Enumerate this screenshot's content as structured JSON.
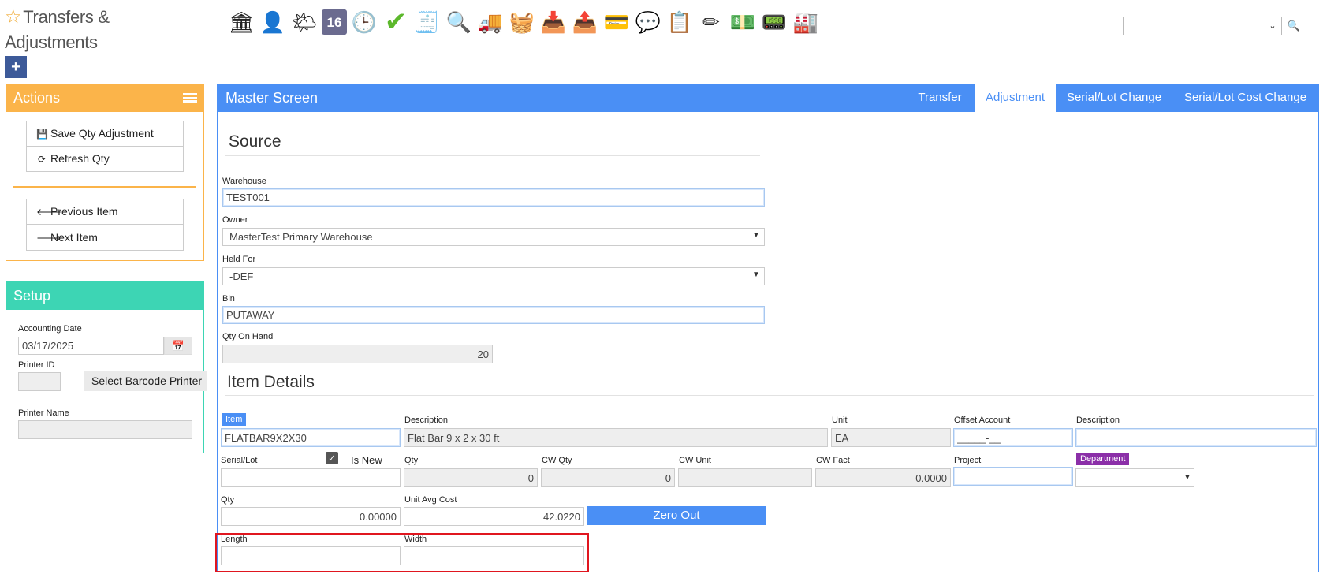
{
  "page": {
    "title": "Transfers & Adjustments"
  },
  "toolbar": {
    "icons": [
      {
        "name": "bank",
        "glyph": "🏛"
      },
      {
        "name": "user",
        "glyph": "👤"
      },
      {
        "name": "weather",
        "glyph": "🌤"
      },
      {
        "name": "calendar-16",
        "glyph": "16"
      },
      {
        "name": "clock",
        "glyph": "🕒"
      },
      {
        "name": "checkmark",
        "glyph": "✔"
      },
      {
        "name": "register",
        "glyph": "🧾"
      },
      {
        "name": "magnifier",
        "glyph": "🔍"
      },
      {
        "name": "truck",
        "glyph": "🚚"
      },
      {
        "name": "basket",
        "glyph": "🧺"
      },
      {
        "name": "inbox-download",
        "glyph": "📥"
      },
      {
        "name": "outbox-upload",
        "glyph": "📤"
      },
      {
        "name": "hand-money",
        "glyph": "💳"
      },
      {
        "name": "dollar-chat",
        "glyph": "💬"
      },
      {
        "name": "clipboard",
        "glyph": "📋"
      },
      {
        "name": "pencil-doc",
        "glyph": "✏"
      },
      {
        "name": "cash",
        "glyph": "💵"
      },
      {
        "name": "dashboard",
        "glyph": "📟"
      },
      {
        "name": "factory",
        "glyph": "🏭"
      }
    ]
  },
  "search": {
    "value": "",
    "dropdown_glyph": "⌄",
    "button_glyph": "🔍"
  },
  "actions": {
    "title": "Actions",
    "save": "Save Qty Adjustment",
    "refresh": "Refresh Qty",
    "previous": "Previous Item",
    "next": "Next Item"
  },
  "setup": {
    "title": "Setup",
    "accounting_date_label": "Accounting Date",
    "accounting_date": "03/17/2025",
    "printer_id_label": "Printer ID",
    "printer_id": "",
    "select_printer": "Select Barcode Printer",
    "printer_name_label": "Printer Name",
    "printer_name": ""
  },
  "master": {
    "title": "Master Screen",
    "tabs": [
      "Transfer",
      "Adjustment",
      "Serial/Lot Change",
      "Serial/Lot Cost Change"
    ],
    "active_tab": "Adjustment"
  },
  "source": {
    "title": "Source",
    "warehouse_label": "Warehouse",
    "warehouse": "TEST001",
    "owner_label": "Owner",
    "owner": "MasterTest Primary Warehouse",
    "held_for_label": "Held For",
    "held_for": "-DEF",
    "bin_label": "Bin",
    "bin": "PUTAWAY",
    "qty_on_hand_label": "Qty On Hand",
    "qty_on_hand": "20"
  },
  "item": {
    "title": "Item Details",
    "item_label": "Item",
    "item": "FLATBAR9X2X30",
    "description_label": "Description",
    "description": "Flat Bar 9 x 2 x 30 ft",
    "unit_label": "Unit",
    "unit": "EA",
    "offset_account_label": "Offset Account",
    "offset_account": "_____-__",
    "description2_label": "Description",
    "description2": "",
    "serial_lot_label": "Serial/Lot",
    "serial_lot": "",
    "is_new_label": "Is New",
    "is_new": true,
    "qty_label": "Qty",
    "qty_readonly": "0",
    "cw_qty_label": "CW Qty",
    "cw_qty": "0",
    "cw_unit_label": "CW Unit",
    "cw_unit": "",
    "cw_fact_label": "CW Fact",
    "cw_fact": "0.0000",
    "project_label": "Project",
    "project": "",
    "department_label": "Department",
    "department": "",
    "qty2_label": "Qty",
    "qty2": "0.00000",
    "unit_avg_cost_label": "Unit Avg Cost",
    "unit_avg_cost": "42.0220",
    "zero_out": "Zero Out",
    "length_label": "Length",
    "length": "",
    "width_label": "Width",
    "width": ""
  },
  "colors": {
    "actions": "#fbb44a",
    "setup": "#3dd5b4",
    "master": "#4a8ff5",
    "department_badge": "#8b2fa8",
    "highlight_box": "#e0161f"
  }
}
